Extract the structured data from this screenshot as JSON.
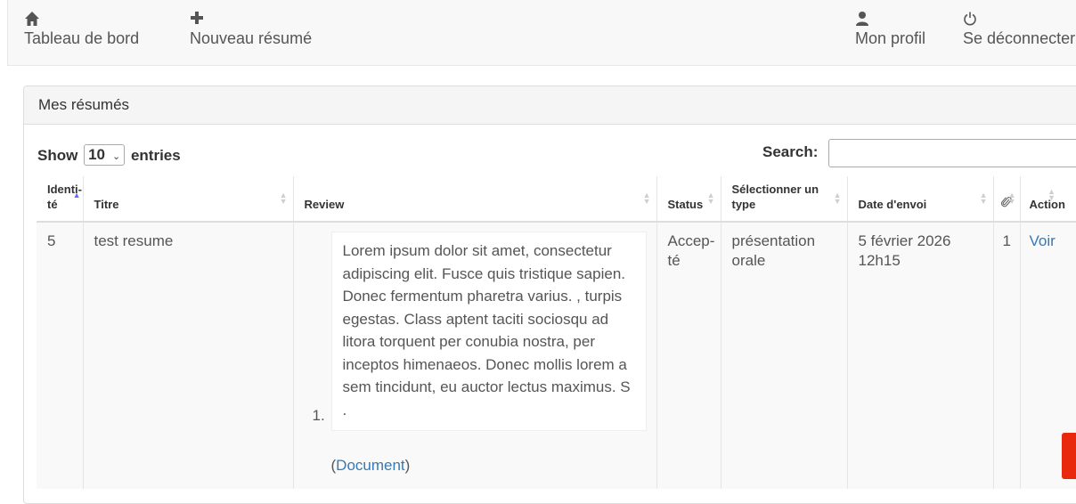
{
  "nav": {
    "dashboard": "Tableau de bord",
    "new_summary": "Nouveau résumé",
    "profile": "Mon profil",
    "logout": "Se déconnecter"
  },
  "panel": {
    "title": "Mes résumés"
  },
  "table_controls": {
    "show": "Show",
    "entries_value": "10",
    "entries": "entries",
    "search_label": "Search:",
    "search_value": ""
  },
  "table": {
    "headers": {
      "identite": "Identi­té",
      "titre": "Titre",
      "review": "Review",
      "status": "Status",
      "type": "Sélectionner un type",
      "date": "Date d'envoi",
      "attachments_icon": "paperclip-icon",
      "action": "Actio­n"
    },
    "rows": [
      {
        "id": "5",
        "titre": "test resume",
        "review_num": "1.",
        "review": "Lorem ipsum dolor sit amet, consectetur adipiscing elit. Fusce quis tristique sapien. Donec fermentum pharetra varius. , turpis egestas. Class aptent taciti sociosqu ad litora torquent per conubia nostra, per inceptos himenaeos. Donec mollis lorem a sem tincidunt, eu auctor lectus maximus. S .",
        "doc_open": "(",
        "doc_link": "Document",
        "doc_close": ")",
        "status": "Accep­té",
        "type": "présentation orale",
        "date": "5 février 2026 12h15",
        "attachments": "1",
        "action": "Voir"
      }
    ]
  },
  "colors": {
    "link": "#337ab7",
    "danger": "#e8290b",
    "sort_active": "#6a6aff"
  }
}
